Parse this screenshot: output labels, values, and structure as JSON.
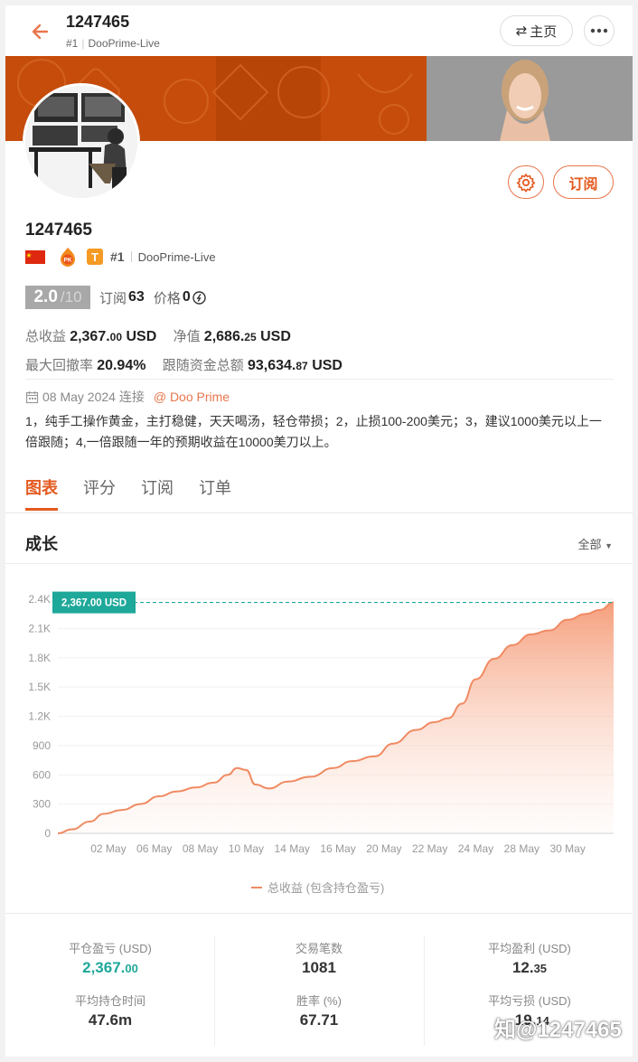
{
  "header": {
    "title": "1247465",
    "rank": "#1",
    "broker": "DooPrime-Live",
    "home_label": "主页"
  },
  "colors": {
    "accent": "#e35a1f",
    "banner": "#c64c0b",
    "green": "#1ea89a",
    "line": "#f08a62"
  },
  "profile": {
    "name": "1247465",
    "rank": "#1",
    "broker": "DooPrime-Live",
    "subscribe_label": "订阅",
    "score": "2.0",
    "score_max": "/10",
    "subscriptions_label": "订阅",
    "subscriptions": "63",
    "price_label": "价格",
    "price": "0",
    "total_profit_label": "总收益",
    "total_profit": "2,367.",
    "total_profit_dec": "00",
    "total_profit_unit": "USD",
    "equity_label": "净值",
    "equity": "2,686.",
    "equity_dec": "25",
    "equity_unit": "USD",
    "drawdown_label": "最大回撤率",
    "drawdown": "20.94%",
    "follow_funds_label": "跟随资金总额",
    "follow_funds": "93,634.",
    "follow_funds_dec": "87",
    "follow_funds_unit": "USD",
    "date": "08 May 2024 连接",
    "broker_link": "@ Doo Prime",
    "description": "1，纯手工操作黄金，主打稳健，天天喝汤，轻仓带损；2，止损100-200美元；3，建议1000美元以上一倍跟随；4,一倍跟随一年的预期收益在10000美刀以上。"
  },
  "tabs": [
    {
      "label": "图表",
      "active": true
    },
    {
      "label": "评分",
      "active": false
    },
    {
      "label": "订阅",
      "active": false
    },
    {
      "label": "订单",
      "active": false
    }
  ],
  "section": {
    "title": "成长",
    "filter": "全部"
  },
  "chart_data": {
    "type": "area",
    "title": "",
    "xlabel": "",
    "ylabel": "",
    "ylim": [
      0,
      2400
    ],
    "yticks": [
      "0",
      "300",
      "600",
      "900",
      "1.2K",
      "1.5K",
      "1.8K",
      "2.1K",
      "2.4K"
    ],
    "xticks": [
      "02 May",
      "06 May",
      "08 May",
      "10 May",
      "14 May",
      "16 May",
      "20 May",
      "22 May",
      "24 May",
      "28 May",
      "30 May"
    ],
    "series": [
      {
        "name": "总收益 (包含持仓盈亏)",
        "points": [
          [
            0,
            0
          ],
          [
            0.3,
            40
          ],
          [
            0.7,
            120
          ],
          [
            1.0,
            200
          ],
          [
            1.4,
            240
          ],
          [
            1.8,
            300
          ],
          [
            2.2,
            380
          ],
          [
            2.6,
            430
          ],
          [
            3.0,
            470
          ],
          [
            3.4,
            520
          ],
          [
            3.7,
            600
          ],
          [
            3.9,
            670
          ],
          [
            4.1,
            650
          ],
          [
            4.3,
            500
          ],
          [
            4.6,
            460
          ],
          [
            5.0,
            530
          ],
          [
            5.5,
            580
          ],
          [
            6.0,
            670
          ],
          [
            6.4,
            740
          ],
          [
            6.9,
            790
          ],
          [
            7.3,
            920
          ],
          [
            7.8,
            1060
          ],
          [
            8.2,
            1140
          ],
          [
            8.5,
            1180
          ],
          [
            8.8,
            1330
          ],
          [
            9.1,
            1580
          ],
          [
            9.5,
            1790
          ],
          [
            9.9,
            1930
          ],
          [
            10.3,
            2040
          ],
          [
            10.7,
            2080
          ],
          [
            11.1,
            2190
          ],
          [
            11.5,
            2250
          ],
          [
            11.8,
            2290
          ],
          [
            12.1,
            2367
          ]
        ]
      }
    ],
    "last_value_label": "2,367.00 USD",
    "legend": "总收益 (包含持仓盈亏)",
    "legend_position": "bottom",
    "grid": true
  },
  "stats": [
    {
      "label": "平仓盈亏 (USD)",
      "value": "2,367.",
      "dec": "00",
      "green": true
    },
    {
      "label": "交易笔数",
      "value": "1081",
      "dec": ""
    },
    {
      "label": "平均盈利 (USD)",
      "value": "12.",
      "dec": "35"
    },
    {
      "label": "平均持仓时间",
      "value": "47.6m",
      "dec": ""
    },
    {
      "label": "胜率 (%)",
      "value": "67.71",
      "dec": ""
    },
    {
      "label": "平均亏损 (USD)",
      "value": "-19.",
      "dec": "14"
    }
  ],
  "watermark": "知@1247465"
}
